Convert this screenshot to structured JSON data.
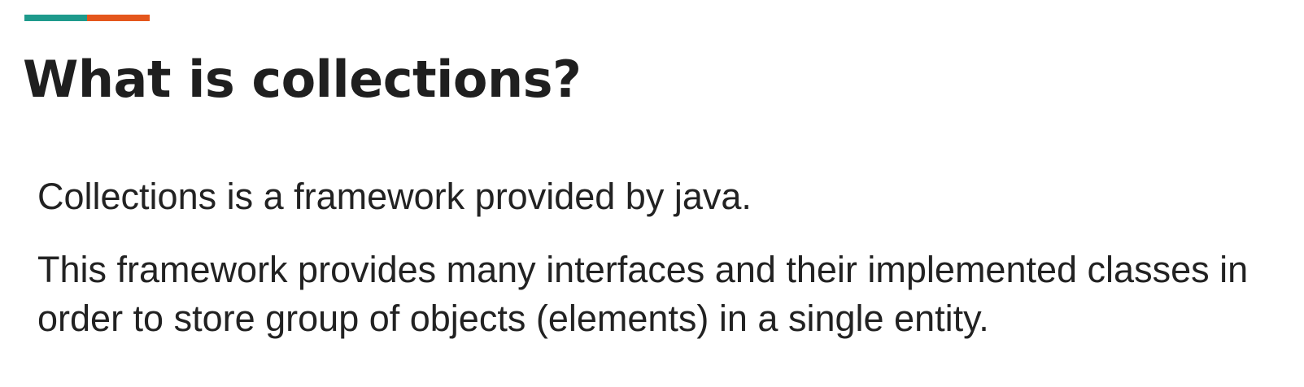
{
  "accent_bar": {
    "colors": [
      "#1e9a8c",
      "#e4561c"
    ]
  },
  "slide": {
    "title": "What is collections?",
    "paragraphs": [
      "Collections is a framework provided by java.",
      "This framework provides many interfaces and their implemented classes in order to store group of objects (elements) in a single entity."
    ]
  }
}
